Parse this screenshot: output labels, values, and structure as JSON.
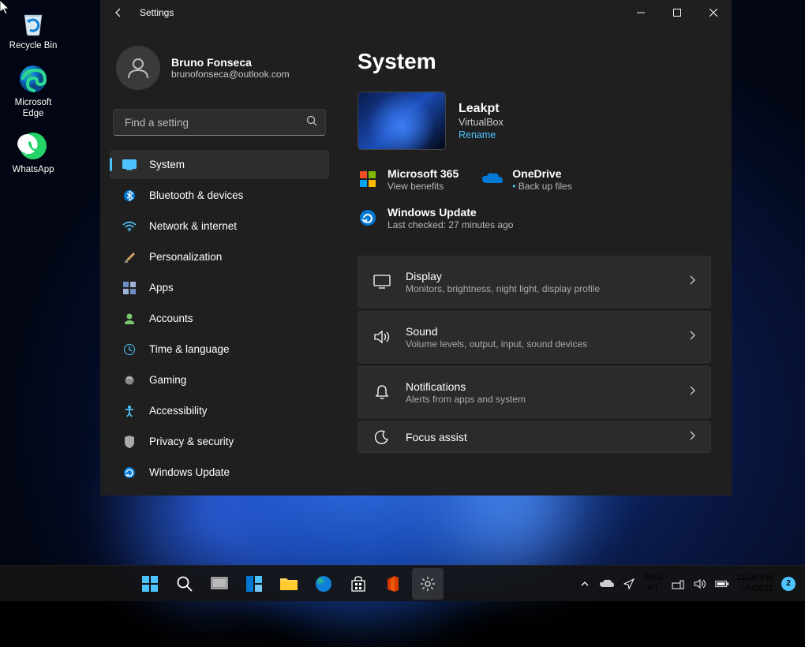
{
  "desktop": {
    "icons": [
      {
        "name": "Recycle Bin"
      },
      {
        "name": "Microsoft Edge"
      },
      {
        "name": "WhatsApp"
      }
    ]
  },
  "window": {
    "title": "Settings",
    "profile": {
      "name": "Bruno Fonseca",
      "email": "brunofonseca@outlook.com"
    },
    "search_placeholder": "Find a setting",
    "nav": [
      {
        "label": "System",
        "icon": "system"
      },
      {
        "label": "Bluetooth & devices",
        "icon": "bluetooth"
      },
      {
        "label": "Network & internet",
        "icon": "wifi"
      },
      {
        "label": "Personalization",
        "icon": "brush"
      },
      {
        "label": "Apps",
        "icon": "apps"
      },
      {
        "label": "Accounts",
        "icon": "person"
      },
      {
        "label": "Time & language",
        "icon": "clock"
      },
      {
        "label": "Gaming",
        "icon": "game"
      },
      {
        "label": "Accessibility",
        "icon": "accessibility"
      },
      {
        "label": "Privacy & security",
        "icon": "shield"
      },
      {
        "label": "Windows Update",
        "icon": "update"
      }
    ],
    "main": {
      "heading": "System",
      "device": {
        "name": "Leakpt",
        "model": "VirtualBox",
        "rename": "Rename"
      },
      "services": [
        {
          "name": "Microsoft 365",
          "desc": "View benefits",
          "icon": "m365"
        },
        {
          "name": "OneDrive",
          "desc": "Back up files",
          "icon": "onedrive",
          "bullet": true
        },
        {
          "name": "Windows Update",
          "desc": "Last checked: 27 minutes ago",
          "icon": "update"
        }
      ],
      "cards": [
        {
          "title": "Display",
          "desc": "Monitors, brightness, night light, display profile",
          "icon": "display"
        },
        {
          "title": "Sound",
          "desc": "Volume levels, output, input, sound devices",
          "icon": "sound"
        },
        {
          "title": "Notifications",
          "desc": "Alerts from apps and system",
          "icon": "bell"
        },
        {
          "title": "Focus assist",
          "desc": "",
          "icon": "moon"
        }
      ]
    }
  },
  "taskbar": {
    "lang1": "ENG",
    "lang2": "PT",
    "time": "11:00 PM",
    "date": "7/5/2021",
    "notif_count": "2"
  }
}
